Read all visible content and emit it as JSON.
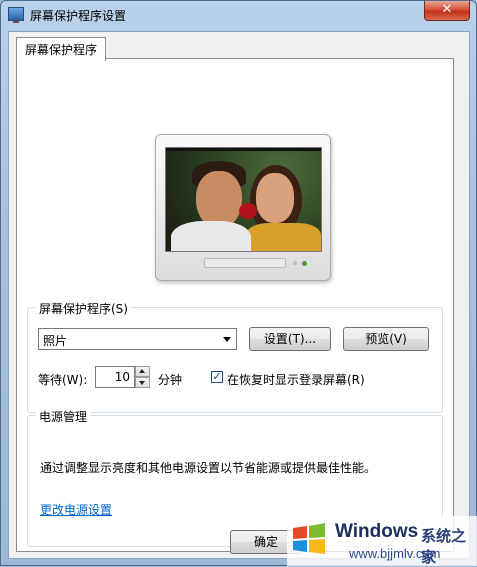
{
  "window": {
    "title": "屏幕保护程序设置",
    "close_label": "✕"
  },
  "tabs": [
    {
      "label": "屏幕保护程序"
    }
  ],
  "screensaver": {
    "group_label": "屏幕保护程序(S)",
    "selected": "照片",
    "settings_button": "设置(T)...",
    "preview_button": "预览(V)",
    "wait_label": "等待(W):",
    "wait_value": "10",
    "wait_unit": "分钟",
    "resume_checkbox_label": "在恢复时显示登录屏幕(R)",
    "resume_checked": true
  },
  "power": {
    "group_label": "电源管理",
    "description": "通过调整显示亮度和其他电源设置以节省能源或提供最佳性能。",
    "link": "更改电源设置"
  },
  "footer": {
    "ok_button": "确定"
  },
  "watermark": {
    "brand": "Windows",
    "brand_cn": "系统之家",
    "url": "www.bjjmlv.com"
  },
  "colors": {
    "link": "#0066cc",
    "close": "#c2301c"
  }
}
